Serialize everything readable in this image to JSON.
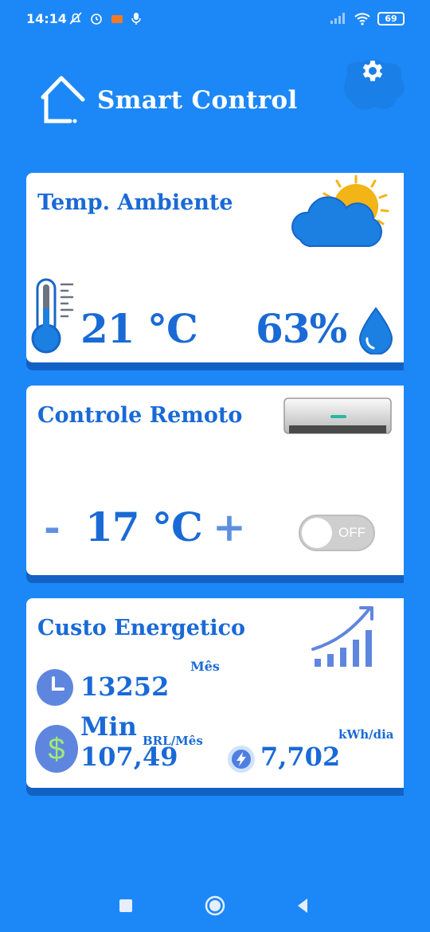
{
  "status_bar": {
    "time": "14:14",
    "battery": "69",
    "icons": [
      "mute-icon",
      "alarm-icon",
      "video-icon",
      "mic-icon",
      "signal-icon",
      "wifi-icon",
      "battery-icon"
    ]
  },
  "header": {
    "title": "Smart Control",
    "home_icon": "home-icon",
    "settings_icon": "gear-icon"
  },
  "ambient": {
    "title": "Temp. Ambiente",
    "temperature": "21",
    "temperature_unit": "°C",
    "humidity": "63%",
    "icons": [
      "weather-icon",
      "thermometer-icon",
      "water-drop-icon"
    ]
  },
  "remote": {
    "title": "Controle Remoto",
    "minus": "-",
    "setpoint": "17",
    "setpoint_unit": "°C",
    "plus": "+",
    "toggle_label": "OFF",
    "icons": [
      "air-conditioner-icon"
    ]
  },
  "energy": {
    "title": "Custo Energetico",
    "period_label": "Mês",
    "minutes_value": "13252",
    "minutes_label": "Min",
    "cost_unit": "BRL/Mês",
    "cost_value": "107,49",
    "kwh_unit": "kWh/dia",
    "kwh_value": "7,702",
    "icons": [
      "growth-chart-icon",
      "clock-icon",
      "dollar-icon",
      "lightning-icon"
    ]
  },
  "colors": {
    "background": "#1c88f7",
    "card": "#ffffff",
    "accent": "#1a6ad6",
    "sun": "#f2b416"
  }
}
